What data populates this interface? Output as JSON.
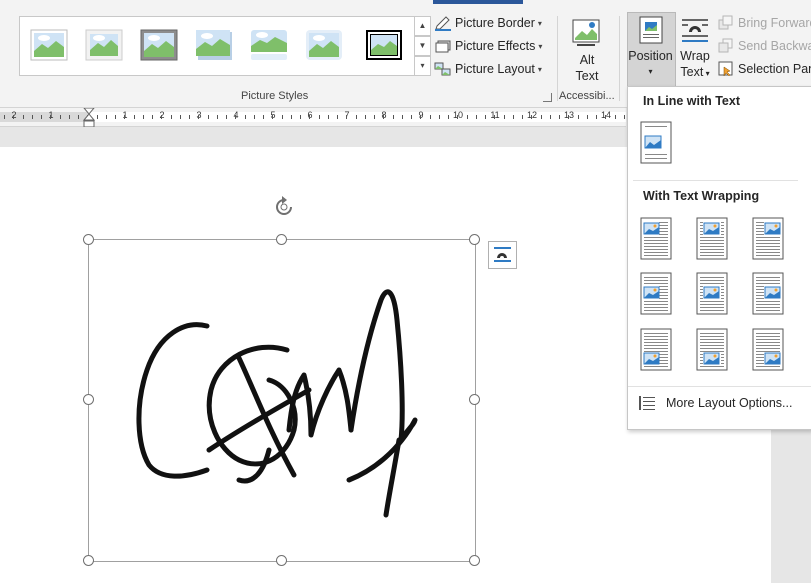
{
  "picture_styles": {
    "group_label": "Picture Styles",
    "styles": [
      {
        "name": "simple-frame-white"
      },
      {
        "name": "beveled-matte-white"
      },
      {
        "name": "metal-frame"
      },
      {
        "name": "drop-shadow-rectangle"
      },
      {
        "name": "reflected-rounded-rectangle"
      },
      {
        "name": "soft-edge-rectangle"
      },
      {
        "name": "double-frame-black"
      }
    ]
  },
  "picture_menu": {
    "border": "Picture Border",
    "effects": "Picture Effects",
    "layout": "Picture Layout"
  },
  "accessibility": {
    "alt_text_line1": "Alt",
    "alt_text_line2": "Text",
    "group_label": "Accessibi..."
  },
  "arrange": {
    "position": "Position",
    "wrap_line1": "Wrap",
    "wrap_line2": "Text",
    "bring_forward": "Bring Forward",
    "send_backward": "Send Backward",
    "selection_pane": "Selection Pane"
  },
  "ruler": {
    "labels": [
      "2",
      "1",
      "1",
      "2",
      "3",
      "4",
      "5",
      "6",
      "7",
      "8",
      "9",
      "10",
      "11",
      "12",
      "13",
      "14"
    ]
  },
  "position_menu": {
    "inline_heading": "In Line with Text",
    "wrapping_heading": "With Text Wrapping",
    "positions": [
      {
        "name": "top-left"
      },
      {
        "name": "top-center"
      },
      {
        "name": "top-right"
      },
      {
        "name": "middle-left"
      },
      {
        "name": "middle-center"
      },
      {
        "name": "middle-right"
      },
      {
        "name": "bottom-left"
      },
      {
        "name": "bottom-center"
      },
      {
        "name": "bottom-right"
      }
    ],
    "more_options": "More Layout Options..."
  },
  "colors": {
    "accent": "#2b579a",
    "selection_border": "#a0a0a0",
    "icon_blue": "#2f7bc4"
  }
}
